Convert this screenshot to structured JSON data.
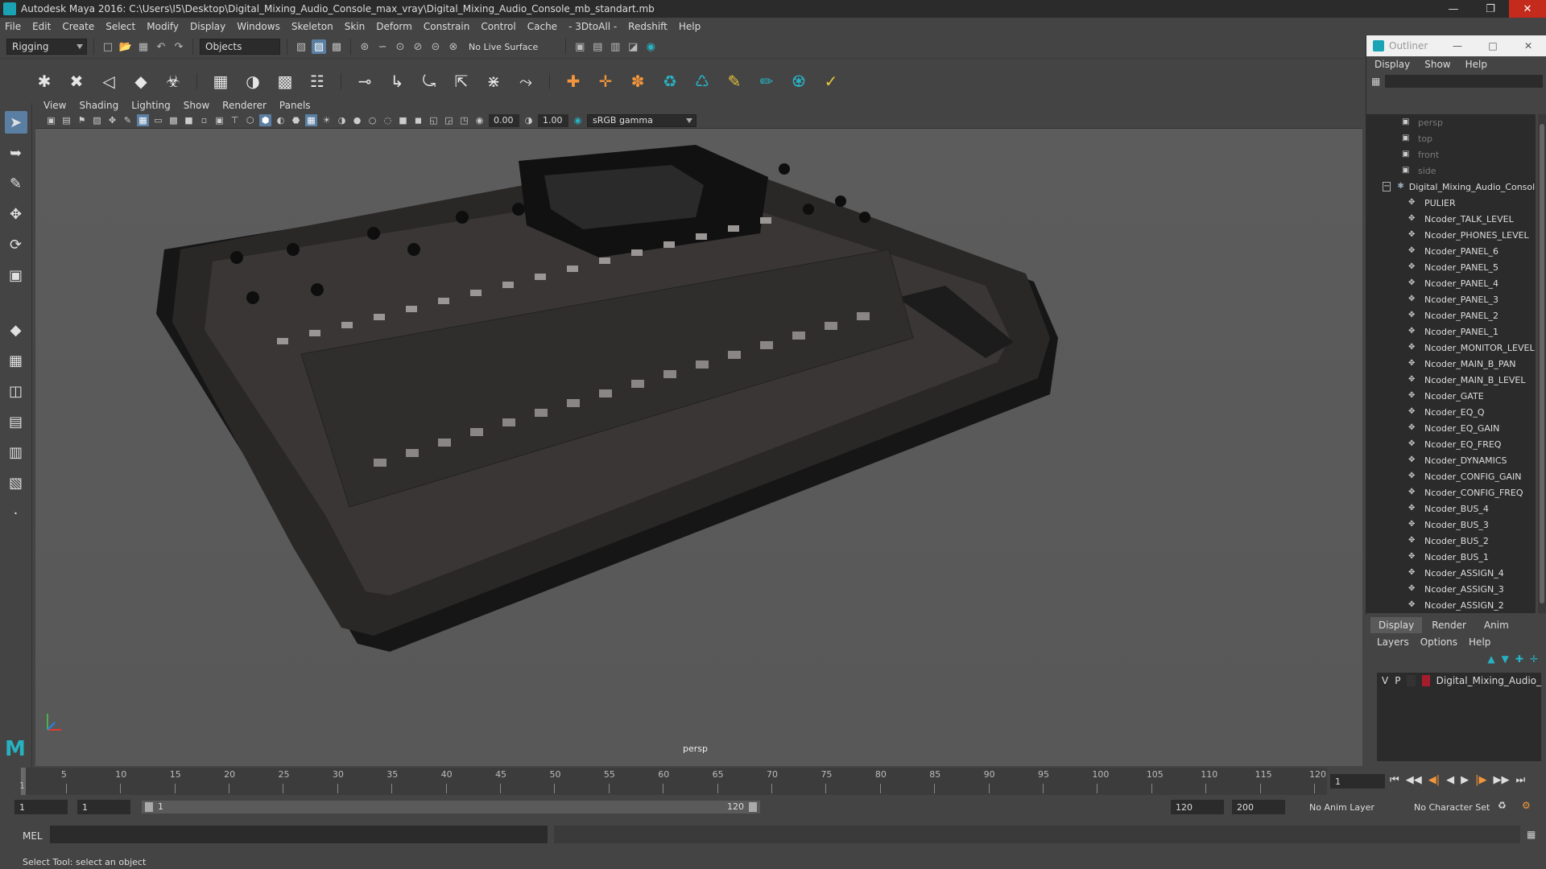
{
  "window": {
    "title": "Autodesk Maya 2016: C:\\Users\\I5\\Desktop\\Digital_Mixing_Audio_Console_max_vray\\Digital_Mixing_Audio_Console_mb_standart.mb"
  },
  "menus": [
    "File",
    "Edit",
    "Create",
    "Select",
    "Modify",
    "Display",
    "Windows",
    "Skeleton",
    "Skin",
    "Deform",
    "Constrain",
    "Control",
    "Cache",
    "- 3DtoAll -",
    "Redshift",
    "Help"
  ],
  "statusline": {
    "menuset": "Rigging",
    "selection_mode": "Objects",
    "live_surface": "No Live Surface"
  },
  "panel": {
    "menus": [
      "View",
      "Shading",
      "Lighting",
      "Show",
      "Renderer",
      "Panels"
    ],
    "exposure": "0.00",
    "gamma": "1.00",
    "color_space": "sRGB gamma",
    "camera_label": "persp"
  },
  "outliner": {
    "title": "Outliner",
    "menus": [
      "Display",
      "Show",
      "Help"
    ],
    "cameras": [
      "persp",
      "top",
      "front",
      "side"
    ],
    "root": "Digital_Mixing_Audio_Console",
    "children": [
      "PULIER",
      "Ncoder_TALK_LEVEL",
      "Ncoder_PHONES_LEVEL",
      "Ncoder_PANEL_6",
      "Ncoder_PANEL_5",
      "Ncoder_PANEL_4",
      "Ncoder_PANEL_3",
      "Ncoder_PANEL_2",
      "Ncoder_PANEL_1",
      "Ncoder_MONITOR_LEVEL",
      "Ncoder_MAIN_B_PAN",
      "Ncoder_MAIN_B_LEVEL",
      "Ncoder_GATE",
      "Ncoder_EQ_Q",
      "Ncoder_EQ_GAIN",
      "Ncoder_EQ_FREQ",
      "Ncoder_DYNAMICS",
      "Ncoder_CONFIG_GAIN",
      "Ncoder_CONFIG_FREQ",
      "Ncoder_BUS_4",
      "Ncoder_BUS_3",
      "Ncoder_BUS_2",
      "Ncoder_BUS_1",
      "Ncoder_ASSIGN_4",
      "Ncoder_ASSIGN_3",
      "Ncoder_ASSIGN_2"
    ]
  },
  "layers": {
    "tabs": [
      "Display",
      "Render",
      "Anim"
    ],
    "menus": [
      "Layers",
      "Options",
      "Help"
    ],
    "rows": [
      {
        "v": "V",
        "p": "P",
        "name": "Digital_Mixing_Audio_",
        "color": "#a51d2d"
      }
    ]
  },
  "timeline": {
    "ticks": [
      "5",
      "10",
      "15",
      "20",
      "25",
      "30",
      "35",
      "40",
      "45",
      "50",
      "55",
      "60",
      "65",
      "70",
      "75",
      "80",
      "85",
      "90",
      "95",
      "100",
      "105",
      "110",
      "115",
      "120"
    ],
    "start_label": "1",
    "current_frame": "1",
    "range_start": "1",
    "range_start2": "1",
    "range_track_start": "1",
    "range_track_end": "120",
    "range_end": "120",
    "anim_end": "200",
    "anim_layer": "No Anim Layer",
    "character_set": "No Character Set"
  },
  "command": {
    "label": "MEL"
  },
  "helpline": "Select Tool: select an object"
}
